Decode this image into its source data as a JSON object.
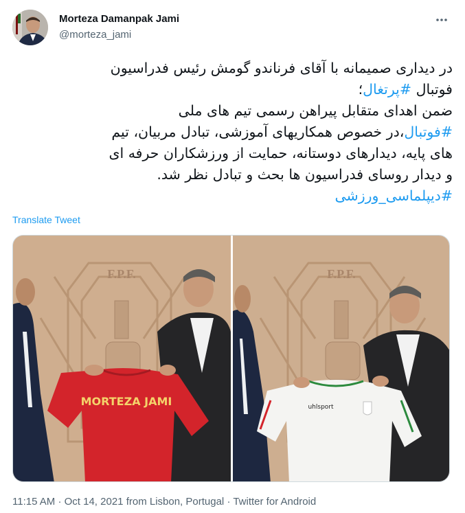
{
  "author": {
    "name": "Morteza Damanpak Jami",
    "handle": "@morteza_jami"
  },
  "menu": {
    "icon": "more-horizontal-icon"
  },
  "tweet": {
    "line1": "در دیداری صمیمانه با آقای فرناندو گومش رئیس فدراسیون",
    "line2_prefix": "فوتبال ",
    "line2_hashtag": "#پرتغال",
    "line2_suffix": "؛",
    "line3": "ضمن اهدای متقابل پیراهن رسمی تیم های ملی",
    "line4_hashtag": "#فوتبال",
    "line4_suffix": "،در خصوص همکاریهای آموزشی، تبادل مربیان، تیم",
    "line5": "های پایه، دیدارهای دوستانه، حمایت از ورزشکاران حرفه ای",
    "line6": "و دیدار روسای فدراسیون ها بحث و تبادل نظر شد.",
    "line7_hashtag": "#دیپلماسی_ورزشی"
  },
  "translate_label": "Translate Tweet",
  "photos": {
    "left": {
      "jersey_text": "MORTEZA JAMI",
      "wall_emblem": "F.P.F."
    },
    "right": {
      "jersey_brand": "uhlsport",
      "wall_emblem": "F.P.F."
    }
  },
  "meta": {
    "time": "11:15 AM",
    "date": "Oct 14, 2021",
    "location": "from Lisbon, Portugal",
    "source": "Twitter for Android",
    "separator": "·"
  },
  "colors": {
    "link": "#1d9bf0",
    "text": "#0f1419",
    "secondary": "#536471"
  }
}
